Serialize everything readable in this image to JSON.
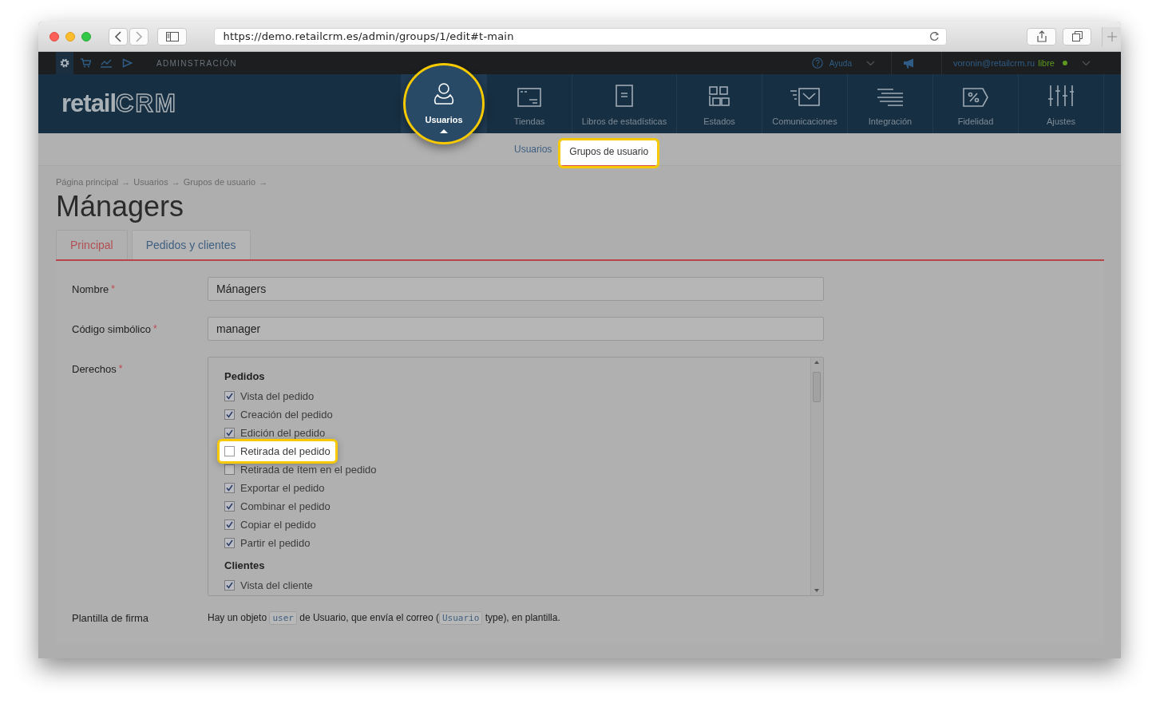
{
  "browser": {
    "url": "https://demo.retailcrm.es/admin/groups/1/edit#t-main"
  },
  "topbar": {
    "section": "ADMINSTRACIÓN",
    "help": "Ayuda",
    "user": "voronin@retailcrm.ru",
    "plan": "libre"
  },
  "logo": {
    "word": "retail",
    "mark": "CRM"
  },
  "nav": [
    {
      "label": "Usuarios",
      "selected": true,
      "highlighted": true
    },
    {
      "label": "Tiendas",
      "selected": false,
      "highlighted": false
    },
    {
      "label": "Libros de estadísticas",
      "selected": false,
      "highlighted": false
    },
    {
      "label": "Estados",
      "selected": false,
      "highlighted": false
    },
    {
      "label": "Comunicaciones",
      "selected": false,
      "highlighted": false
    },
    {
      "label": "Integración",
      "selected": false,
      "highlighted": false
    },
    {
      "label": "Fidelidad",
      "selected": false,
      "highlighted": false
    },
    {
      "label": "Ajustes",
      "selected": false,
      "highlighted": false
    }
  ],
  "subnav": [
    {
      "label": "Usuarios",
      "selected": false,
      "highlighted": false
    },
    {
      "label": "Grupos de usuario",
      "selected": true,
      "highlighted": true
    }
  ],
  "breadcrumb": {
    "items": [
      "Página principal",
      "Usuarios",
      "Grupos de usuario"
    ],
    "separator": "→"
  },
  "title": "Mánagers",
  "tabs": [
    {
      "label": "Principal",
      "selected": true
    },
    {
      "label": "Pedidos y clientes",
      "selected": false
    }
  ],
  "fields": [
    {
      "kind": "text",
      "label": "Nombre",
      "required_mark": "*",
      "value": "Mánagers"
    },
    {
      "kind": "text",
      "label": "Código simbólico",
      "required_mark": "*",
      "value": "manager"
    },
    {
      "kind": "permissions",
      "label": "Derechos",
      "required_mark": "*",
      "groups": [
        {
          "title": "Pedidos",
          "items": [
            {
              "label": "Vista del pedido",
              "checked": true,
              "highlighted": false
            },
            {
              "label": "Creación del pedido",
              "checked": true,
              "highlighted": false
            },
            {
              "label": "Edición del pedido",
              "checked": true,
              "highlighted": false
            },
            {
              "label": "Retirada del pedido",
              "checked": false,
              "highlighted": true
            },
            {
              "label": "Retirada de ítem en el pedido",
              "checked": false,
              "highlighted": false
            },
            {
              "label": "Exportar el pedido",
              "checked": true,
              "highlighted": false
            },
            {
              "label": "Combinar el pedido",
              "checked": true,
              "highlighted": false
            },
            {
              "label": "Copiar el pedido",
              "checked": true,
              "highlighted": false
            },
            {
              "label": "Partir el pedido",
              "checked": true,
              "highlighted": false
            }
          ]
        },
        {
          "title": "Clientes",
          "items": [
            {
              "label": "Vista del cliente",
              "checked": true,
              "highlighted": false
            }
          ]
        }
      ]
    },
    {
      "kind": "note",
      "label": "Plantilla de firma",
      "parts": [
        {
          "kind": "text",
          "text": "Hay un objeto "
        },
        {
          "kind": "code",
          "text": "user"
        },
        {
          "kind": "text",
          "text": " de Usuario, que envía el correo ("
        },
        {
          "kind": "code",
          "text": "Usuario"
        },
        {
          "kind": "text",
          "text": " type), en plantilla."
        }
      ]
    }
  ]
}
